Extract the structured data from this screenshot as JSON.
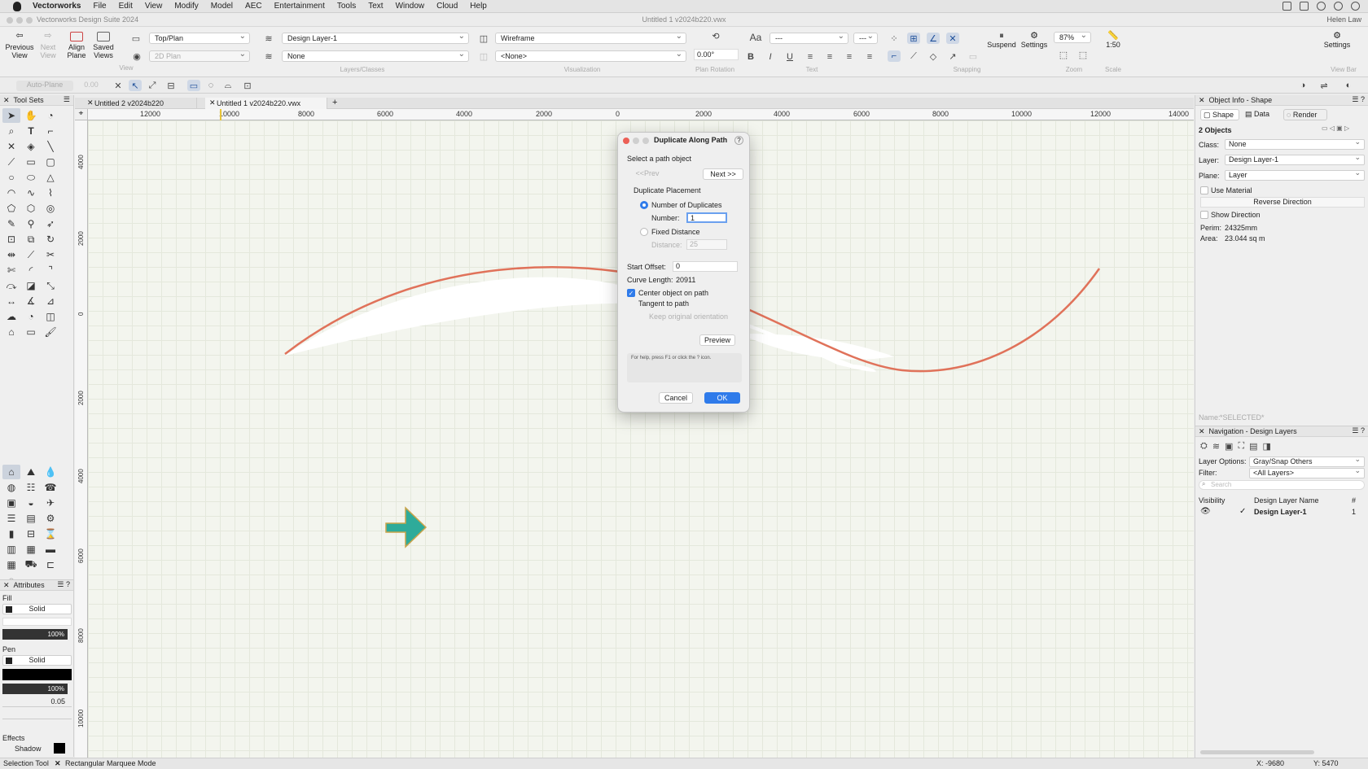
{
  "menubar": {
    "app_name": "Vectorworks",
    "items": [
      "File",
      "Edit",
      "View",
      "Modify",
      "Model",
      "AEC",
      "Entertainment",
      "Tools",
      "Text",
      "Window",
      "Cloud",
      "Help"
    ]
  },
  "titlebar": {
    "app_title": "Vectorworks Design Suite 2024",
    "document_title": "Untitled 1 v2024b220.vwx",
    "user": "Helen Law"
  },
  "toolbar": {
    "previous_view": "Previous\nView",
    "next_view": "Next\nView",
    "align_plane": "Align\nPlane",
    "saved_views": "Saved\nViews",
    "group_view": "View",
    "view_select": "Top/Plan",
    "render_select": "2D Plan",
    "layer_select": "Design Layer-1",
    "class_select": "None",
    "group_layers": "Layers/Classes",
    "wireframe_select": "Wireframe",
    "none_select": "<None>",
    "group_visualization": "Visualization",
    "rotation_value": "0.00°",
    "group_plan_rotation": "Plan Rotation",
    "font_select": "---",
    "size_select": "---",
    "group_text": "Text",
    "group_snapping": "Snapping",
    "suspend": "Suspend",
    "settings": "Settings",
    "zoom_value": "87%",
    "group_zoom": "Zoom",
    "scale_value": "1:50",
    "group_scale": "Scale",
    "right_settings": "Settings",
    "view_bar": "View Bar"
  },
  "modebar": {
    "auto_plane": "Auto-Plane",
    "offset": "0.00"
  },
  "toolsets": {
    "title": "Tool Sets"
  },
  "attributes": {
    "title": "Attributes",
    "fill_label": "Fill",
    "fill_style": "Solid",
    "fill_opacity": "100%",
    "pen_label": "Pen",
    "pen_style": "Solid",
    "pen_opacity": "100%",
    "line_weight": "0.05",
    "effects_label": "Effects",
    "shadow_label": "Shadow"
  },
  "tabs": [
    {
      "label": "Untitled 2 v2024b220"
    },
    {
      "label": "Untitled 1 v2024b220.vwx"
    }
  ],
  "ruler": {
    "h_labels": [
      "12000",
      "10000",
      "8000",
      "6000",
      "4000",
      "2000",
      "0",
      "2000",
      "4000",
      "6000",
      "8000",
      "10000",
      "12000",
      "14000"
    ],
    "v_labels": [
      "4000",
      "2000",
      "0",
      "2000",
      "4000",
      "6000",
      "8000",
      "10000"
    ]
  },
  "dialog": {
    "title": "Duplicate Along Path",
    "help": "?",
    "instruction": "Select a path object",
    "prev": "<<Prev",
    "next": "Next >>",
    "placement_label": "Duplicate Placement",
    "num_dup_label": "Number of Duplicates",
    "number_label": "Number:",
    "number_value": "1",
    "fixed_distance_label": "Fixed Distance",
    "distance_label": "Distance:",
    "distance_value": "25",
    "start_offset_label": "Start Offset:",
    "start_offset_value": "0",
    "curve_length_label": "Curve Length:",
    "curve_length_value": "20911",
    "center_label": "Center object on path",
    "tangent_label": "Tangent to path",
    "keep_orientation_label": "Keep original orientation",
    "preview": "Preview",
    "help_text": "For help, press F1 or click the ? icon.",
    "cancel": "Cancel",
    "ok": "OK"
  },
  "object_info": {
    "title": "Object Info - Shape",
    "tab_shape": "Shape",
    "tab_data": "Data",
    "tab_render": "Render",
    "count": "2 Objects",
    "class_label": "Class:",
    "class_value": "None",
    "layer_label": "Layer:",
    "layer_value": "Design Layer-1",
    "plane_label": "Plane:",
    "plane_value": "Layer",
    "use_material": "Use Material",
    "reverse_direction": "Reverse Direction",
    "show_direction": "Show Direction",
    "perim_label": "Perim:",
    "perim_value": "24325mm",
    "area_label": "Area:",
    "area_value": "23.044 sq m",
    "name_label": "Name:",
    "name_value": "*SELECTED*"
  },
  "navigation": {
    "title": "Navigation - Design Layers",
    "layer_options_label": "Layer Options:",
    "layer_options_value": "Gray/Snap Others",
    "filter_label": "Filter:",
    "filter_value": "<All Layers>",
    "search_placeholder": "Search",
    "col_visibility": "Visibility",
    "col_name": "Design Layer Name",
    "col_num": "#",
    "rows": [
      {
        "name": "Design Layer-1",
        "num": "1"
      }
    ]
  },
  "status": {
    "tool": "Selection Tool",
    "mode": "Rectangular Marquee Mode",
    "x": "X: -9680",
    "y": "Y: 5470"
  },
  "colors": {
    "path_stroke": "#e0725a",
    "arrow_fill": "#2eab9a",
    "accent_blue": "#2f7bea"
  }
}
